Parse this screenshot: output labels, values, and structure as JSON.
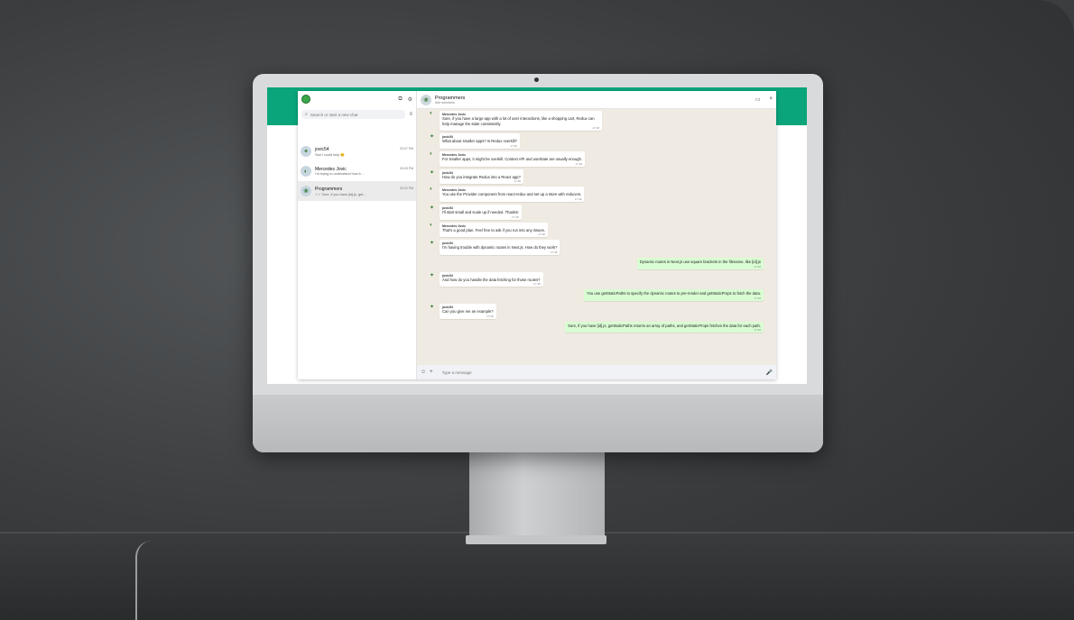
{
  "sidebar": {
    "search_placeholder": "Search or start a new chat",
    "chats": [
      {
        "name": "jovic54",
        "time": "03:07 PM",
        "preview": "Sad I could help 😊"
      },
      {
        "name": "Mercedes Jovic",
        "time": "03:05 PM",
        "preview": "I'm trying to understand how it..."
      },
      {
        "name": "Programmers",
        "time": "03:02 PM",
        "preview": "✓✓ Sure, if you have [id].js, get..."
      }
    ]
  },
  "conversation": {
    "title": "Programmers",
    "subtitle": "See members",
    "composer_placeholder": "Type a message",
    "messages": [
      {
        "dir": "in",
        "sender": "Mercedes Jovic",
        "text": "Sure, if you have a large app with a lot of user interactions, like a shopping cart, Redux can help manage the state consistently.",
        "time": "17:48"
      },
      {
        "dir": "in",
        "sender": "jovic54",
        "text": "What about smaller apps? Is Redux overkill?",
        "time": "17:48"
      },
      {
        "dir": "in",
        "sender": "Mercedes Jovic",
        "text": "For smaller apps, it might be overkill. Context API and useState are usually enough.",
        "time": "17:48"
      },
      {
        "dir": "in",
        "sender": "jovic54",
        "text": "How do you integrate Redux into a React app?",
        "time": "17:48"
      },
      {
        "dir": "in",
        "sender": "Mercedes Jovic",
        "text": "You use the Provider component from react-redux and set up a store with reducers.",
        "time": "17:48"
      },
      {
        "dir": "in",
        "sender": "jovic54",
        "text": "I'll start small and scale up if needed. Thanks!",
        "time": "17:48"
      },
      {
        "dir": "in",
        "sender": "Mercedes Jovic",
        "text": "That's a good plan. Feel free to ask if you run into any issues.",
        "time": "17:48"
      },
      {
        "dir": "in",
        "sender": "jovic54",
        "text": "I'm having trouble with dynamic routes in Next.js. How do they work?",
        "time": "17:48"
      },
      {
        "dir": "out",
        "sender": "",
        "text": "Dynamic routes in Next.js use square brackets in the filename, like [id].js",
        "time": "17:48"
      },
      {
        "dir": "in",
        "sender": "jovic54",
        "text": "And how do you handle the data fetching for those routes?",
        "time": "17:48"
      },
      {
        "dir": "out",
        "sender": "",
        "text": "You use getStaticPaths to specify the dynamic routes to pre-render and getStaticProps to fetch the data.",
        "time": "17:48"
      },
      {
        "dir": "in",
        "sender": "jovic54",
        "text": "Can you give me an example?",
        "time": "17:48"
      },
      {
        "dir": "out",
        "sender": "",
        "text": "Sure, if you have [id].js, getStaticPaths returns an array of paths, and getStaticProps fetches the data for each path.",
        "time": "17:48"
      }
    ]
  }
}
